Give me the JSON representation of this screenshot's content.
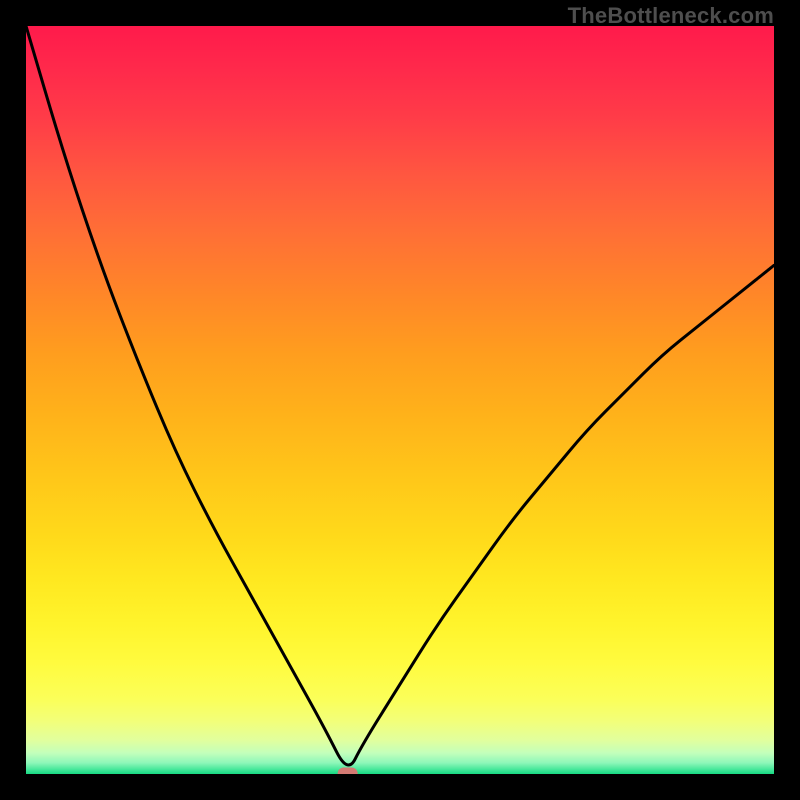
{
  "watermark": "TheBottleneck.com",
  "chart_data": {
    "type": "line",
    "title": "",
    "xlabel": "",
    "ylabel": "",
    "x_range": [
      0,
      100
    ],
    "y_range": [
      0,
      100
    ],
    "min_point": {
      "x": 43,
      "y": 0
    },
    "series": [
      {
        "name": "curve",
        "x": [
          0,
          5,
          10,
          15,
          20,
          25,
          30,
          35,
          40,
          43,
          45,
          50,
          55,
          60,
          65,
          70,
          75,
          80,
          85,
          90,
          95,
          100
        ],
        "y": [
          100,
          83,
          68,
          55,
          43,
          33,
          24,
          15,
          6,
          0,
          4,
          12,
          20,
          27,
          34,
          40,
          46,
          51,
          56,
          60,
          64,
          68
        ]
      }
    ],
    "gradient_stops": [
      {
        "offset": 0.0,
        "color": "#ff1a4b"
      },
      {
        "offset": 0.06,
        "color": "#ff2a4b"
      },
      {
        "offset": 0.12,
        "color": "#ff3b48"
      },
      {
        "offset": 0.2,
        "color": "#ff5740"
      },
      {
        "offset": 0.28,
        "color": "#ff7035"
      },
      {
        "offset": 0.36,
        "color": "#ff8728"
      },
      {
        "offset": 0.44,
        "color": "#ff9e1e"
      },
      {
        "offset": 0.52,
        "color": "#ffb21a"
      },
      {
        "offset": 0.6,
        "color": "#ffc619"
      },
      {
        "offset": 0.68,
        "color": "#ffd91a"
      },
      {
        "offset": 0.74,
        "color": "#ffe820"
      },
      {
        "offset": 0.8,
        "color": "#fff42c"
      },
      {
        "offset": 0.85,
        "color": "#fffb3e"
      },
      {
        "offset": 0.9,
        "color": "#fbff59"
      },
      {
        "offset": 0.93,
        "color": "#f2ff7a"
      },
      {
        "offset": 0.955,
        "color": "#e1ff9e"
      },
      {
        "offset": 0.972,
        "color": "#c3ffbb"
      },
      {
        "offset": 0.985,
        "color": "#8ef7b9"
      },
      {
        "offset": 0.994,
        "color": "#45e79a"
      },
      {
        "offset": 1.0,
        "color": "#17d983"
      }
    ],
    "marker": {
      "x": 43,
      "y": 0,
      "color": "#d47a73"
    },
    "curve_style": {
      "color": "#000000",
      "width": 3
    }
  }
}
